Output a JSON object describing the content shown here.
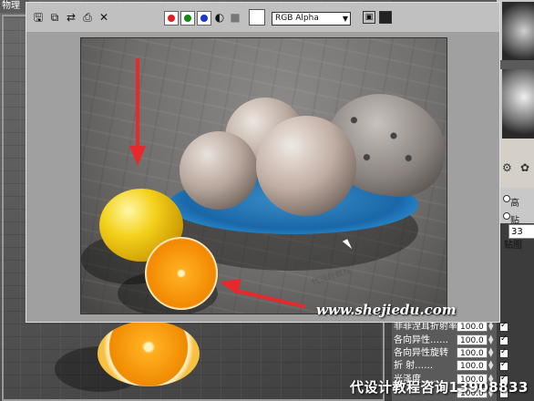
{
  "background": {
    "viewport_label": "物理",
    "panel": {
      "radio_1": "高",
      "radio_2": "贴",
      "number_field": "33",
      "map_label": "贴图"
    },
    "properties": [
      {
        "label": "非菲涅耳折射率",
        "value": "100.0"
      },
      {
        "label": "各向异性……",
        "value": "100.0"
      },
      {
        "label": "各向异性旋转",
        "value": "100.0"
      },
      {
        "label": "折 射……",
        "value": "100.0"
      },
      {
        "label": "光泽度……",
        "value": "100.0"
      },
      {
        "label": "",
        "value": "100.0"
      }
    ]
  },
  "frame_buffer": {
    "toolbar": {
      "save_icon": "save-icon",
      "clone_icon": "clone-icon",
      "track_icon": "track-icon",
      "print_icon": "print-icon",
      "clear_icon": "clear-icon",
      "red_channel": "#e02020",
      "green_channel": "#108a10",
      "blue_channel": "#1a3ad0",
      "channel_select": "RGB Alpha",
      "swatch_color": "#ffffff"
    },
    "render": {
      "arrow_color": "#e8292b"
    }
  },
  "watermarks": {
    "small_1": "daimau.com",
    "small_2": "代设计教程",
    "main": "www.shejiedu.com",
    "bottom": "代设计教程咨询13908833"
  }
}
